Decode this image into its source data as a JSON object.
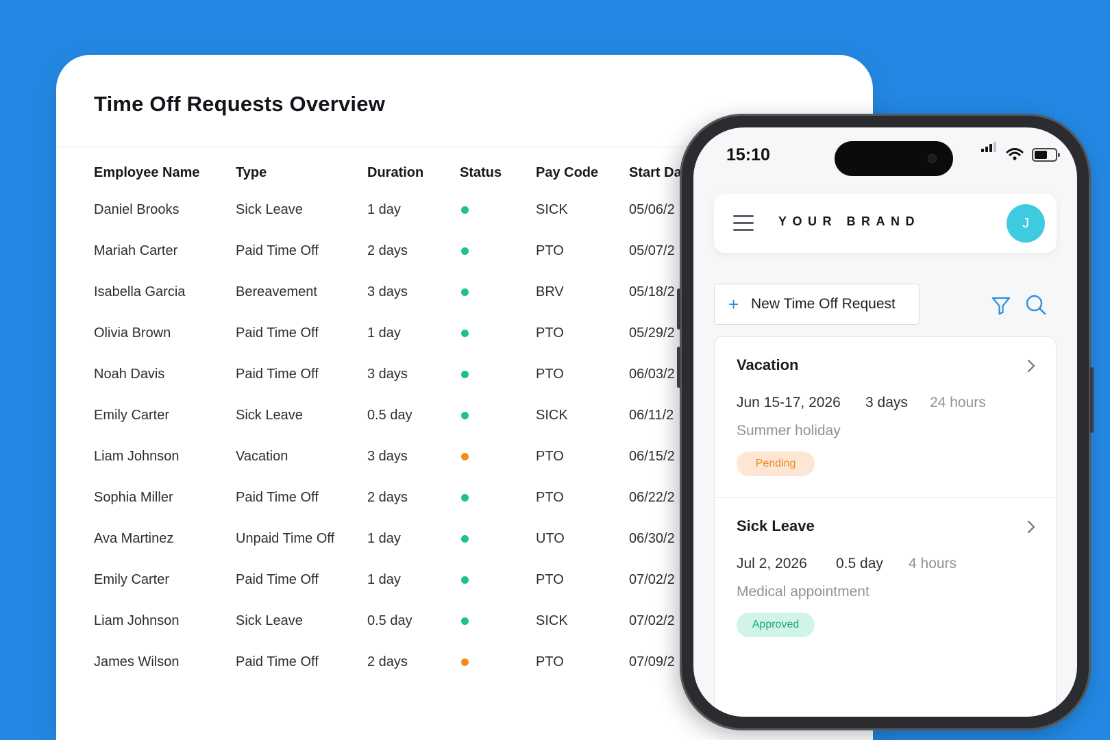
{
  "overview": {
    "title": "Time Off Requests Overview",
    "columns": [
      "Employee Name",
      "Type",
      "Duration",
      "Status",
      "Pay Code",
      "Start Da"
    ],
    "rows": [
      {
        "name": "Daniel Brooks",
        "type": "Sick Leave",
        "duration": "1 day",
        "status": "green",
        "pay_code": "SICK",
        "start": "05/06/2"
      },
      {
        "name": "Mariah Carter",
        "type": "Paid Time Off",
        "duration": "2 days",
        "status": "green",
        "pay_code": "PTO",
        "start": "05/07/2"
      },
      {
        "name": "Isabella Garcia",
        "type": "Bereavement",
        "duration": "3 days",
        "status": "green",
        "pay_code": "BRV",
        "start": "05/18/2"
      },
      {
        "name": "Olivia Brown",
        "type": "Paid Time Off",
        "duration": "1 day",
        "status": "green",
        "pay_code": "PTO",
        "start": "05/29/2"
      },
      {
        "name": "Noah Davis",
        "type": "Paid Time Off",
        "duration": "3 days",
        "status": "green",
        "pay_code": "PTO",
        "start": "06/03/2"
      },
      {
        "name": "Emily Carter",
        "type": "Sick Leave",
        "duration": "0.5 day",
        "status": "green",
        "pay_code": "SICK",
        "start": "06/11/2"
      },
      {
        "name": "Liam Johnson",
        "type": "Vacation",
        "duration": "3 days",
        "status": "orange",
        "pay_code": "PTO",
        "start": "06/15/2"
      },
      {
        "name": "Sophia Miller",
        "type": "Paid Time Off",
        "duration": "2 days",
        "status": "green",
        "pay_code": "PTO",
        "start": "06/22/2"
      },
      {
        "name": "Ava Martinez",
        "type": "Unpaid Time Off",
        "duration": "1 day",
        "status": "green",
        "pay_code": "UTO",
        "start": "06/30/2"
      },
      {
        "name": "Emily Carter",
        "type": "Paid Time Off",
        "duration": "1 day",
        "status": "green",
        "pay_code": "PTO",
        "start": "07/02/2"
      },
      {
        "name": "Liam Johnson",
        "type": "Sick Leave",
        "duration": "0.5 day",
        "status": "green",
        "pay_code": "SICK",
        "start": "07/02/2"
      },
      {
        "name": "James Wilson",
        "type": "Paid Time Off",
        "duration": "2 days",
        "status": "orange",
        "pay_code": "PTO",
        "start": "07/09/2"
      }
    ]
  },
  "phone": {
    "time": "15:10",
    "brand": "YOUR BRAND",
    "avatar_initial": "J",
    "new_request_label": "New Time Off Request",
    "requests": [
      {
        "title": "Vacation",
        "dates": "Jun 15-17, 2026",
        "duration": "3 days",
        "hours": "24 hours",
        "note": "Summer holiday",
        "status": "Pending"
      },
      {
        "title": "Sick Leave",
        "dates": "Jul 2, 2026",
        "duration": "0.5 day",
        "hours": "4 hours",
        "note": "Medical appointment",
        "status": "Approved"
      }
    ]
  },
  "colors": {
    "background": "#2388e3",
    "status_green": "#1fc08a",
    "status_orange": "#f58a1f",
    "accent": "#2b8fe0",
    "avatar": "#3ecbe0"
  }
}
